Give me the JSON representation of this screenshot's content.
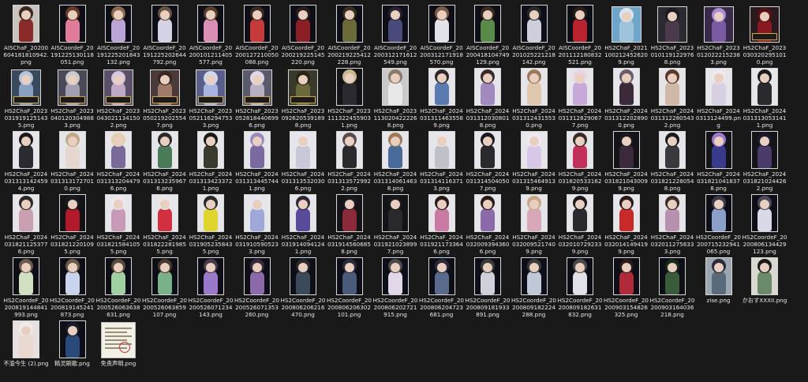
{
  "files": [
    {
      "name": "AISChaF_20200604181810942.png",
      "kind": "portrait",
      "bg": "#c9c3be",
      "fig": "#8b2a2a",
      "hair": "#3a2622"
    },
    {
      "name": "AISCoordeF_20191225130118051.png",
      "kind": "portrait",
      "bg": "#0e0e16",
      "fig": "#e07c9a",
      "hair": "#6a3b2a"
    },
    {
      "name": "AISCoordeF_20191225201843132.png",
      "kind": "portrait",
      "bg": "#0e0e16",
      "fig": "#b9a5d6",
      "hair": "#8a6a4a"
    },
    {
      "name": "AISCoordeF_20191225202644792.png",
      "kind": "portrait",
      "bg": "#0e0e16",
      "fig": "#d6d2e6",
      "hair": "#6a5040"
    },
    {
      "name": "AISCoordeF_20200101211405577.png",
      "kind": "portrait",
      "bg": "#0e0e16",
      "fig": "#d98fb5",
      "hair": "#5a3d2a"
    },
    {
      "name": "AISCoordeF_20200127210050088.png",
      "kind": "portrait",
      "bg": "#0e0e16",
      "fig": "#c73a3a",
      "hair": "#3a2a22"
    },
    {
      "name": "AISCoordeF_20200219225145220.png",
      "kind": "portrait",
      "bg": "#0e0e16",
      "fig": "#8a1f26",
      "hair": "#2a1e1e"
    },
    {
      "name": "AISCoordeF_20200219225412228.png",
      "kind": "portrait",
      "bg": "#0e0e16",
      "fig": "#6a6a3a",
      "hair": "#3a2e20"
    },
    {
      "name": "AISCoordeF_20200312171612549.png",
      "kind": "portrait",
      "bg": "#0e0e16",
      "fig": "#4a4a7a",
      "hair": "#2a2030"
    },
    {
      "name": "AISCoordeF_20200312171918570.png",
      "kind": "portrait",
      "bg": "#0e0e16",
      "fig": "#e2e2ea",
      "hair": "#7a5a4a"
    },
    {
      "name": "AISCoordeF_20200418104749129.png",
      "kind": "portrait",
      "bg": "#0e0e16",
      "fig": "#5a8a4a",
      "hair": "#3a2a20"
    },
    {
      "name": "AISCoordeF_20201025221218142.png",
      "kind": "portrait",
      "bg": "#0e0e16",
      "fig": "#cfcfdc",
      "hair": "#2a2a2a"
    },
    {
      "name": "AISCoordeF_20201112180832521.png",
      "kind": "portrait",
      "bg": "#0e0e16",
      "fig": "#b8232e",
      "hair": "#2a1a1a"
    },
    {
      "name": "HS2ChaF_20211002124526209.png",
      "kind": "square",
      "bg": "#6fa5c9",
      "fig": "#9ec3db",
      "hair": "#d8e4ee"
    },
    {
      "name": "HS2ChaF_20230101191229768.png",
      "kind": "square",
      "bg": "#2a2a30",
      "fig": "#4a3a4a",
      "hair": "#1a1a22"
    },
    {
      "name": "HS2ChaF_20230120222152383.png",
      "kind": "square",
      "bg": "#3a2a4a",
      "fig": "#7a5aa0",
      "hair": "#a78cd6"
    },
    {
      "name": "HS2ChaF_20230303202951010.png",
      "kind": "square",
      "bg": "#2a1a1e",
      "fig": "#8a1a22",
      "hair": "#5a1016",
      "badge": true
    },
    {
      "name": "HS2ChaF_20230319191251435.png",
      "kind": "square",
      "bg": "#3a4a5e",
      "fig": "#8aa0c0",
      "hair": "#b6c4d8",
      "badge": true
    },
    {
      "name": "HS2ChaF_20230401203049883.png",
      "kind": "square",
      "bg": "#4a4a56",
      "fig": "#a0a0b0",
      "hair": "#c8c8d2",
      "badge": true
    },
    {
      "name": "HS2ChaF_20230430211341502.png",
      "kind": "square",
      "bg": "#5a5068",
      "fig": "#c0a8c8",
      "hair": "#d6c6e0",
      "badge": true
    },
    {
      "name": "HS2ChaF_20230502192025547.png",
      "kind": "square",
      "bg": "#4a3a3a",
      "fig": "#a07a6a",
      "hair": "#3a2622",
      "badge": true
    },
    {
      "name": "HS2ChaF_20230521162947533.png",
      "kind": "square",
      "bg": "#5a5e8a",
      "fig": "#a8b4e0",
      "hair": "#d2d8f0",
      "badge": true
    },
    {
      "name": "HS2ChaF_20230528184406996.png",
      "kind": "square",
      "bg": "#5a5a6a",
      "fig": "#b8b0c0",
      "hair": "#e0d8e8",
      "badge": true
    },
    {
      "name": "HS2ChaF_20230926205391898.png",
      "kind": "square",
      "bg": "#3a3a2a",
      "fig": "#6a6a3a",
      "hair": "#2a2418",
      "badge": true
    },
    {
      "name": "HS2ChaF_20231113224559031.png",
      "kind": "portrait",
      "bg": "#141418",
      "fig": "#2a2a30",
      "hair": "#c8b890"
    },
    {
      "name": "HS2ChaF_20231130204222268.png",
      "kind": "portrait",
      "bg": "#c9c9c9",
      "fig": "#e8e8e8",
      "hair": "#8a7a6a"
    },
    {
      "name": "HS2ChaF_20240313114635589.png",
      "kind": "portrait",
      "bg": "#e6e6ea",
      "fig": "#5a7ab0",
      "hair": "#2a2a2a"
    },
    {
      "name": "HS2ChaF_20240313120308018.png",
      "kind": "portrait",
      "bg": "#e6e6ea",
      "fig": "#a08ac0",
      "hair": "#3a2a2a"
    },
    {
      "name": "HS2ChaF_20240313124315530.png",
      "kind": "portrait",
      "bg": "#e6e6ea",
      "fig": "#e0c8b0",
      "hair": "#9a7a5a"
    },
    {
      "name": "HS2ChaF_20240313128290677.png",
      "kind": "portrait",
      "bg": "#e6e6ea",
      "fig": "#c8a8d8",
      "hair": "#e6d6e6"
    },
    {
      "name": "HS2ChaF_20240313122028900.png",
      "kind": "portrait",
      "bg": "#e6e6ea",
      "fig": "#3a2a3a",
      "hair": "#6a5a6a"
    },
    {
      "name": "HS2ChaF_20240313122805432.png",
      "kind": "portrait",
      "bg": "#e6e6ea",
      "fig": "#d0b8a8",
      "hair": "#5a3a2a"
    },
    {
      "name": "HS2ChaF_20240313124499.png",
      "kind": "portrait",
      "bg": "#e6e6ea",
      "fig": "#d6d0e0",
      "hair": "#efe8f0"
    },
    {
      "name": "HS2ChaF_20240313130531411.png",
      "kind": "portrait",
      "bg": "#e6e6ea",
      "fig": "#2a2a2e",
      "hair": "#1a1a1a"
    },
    {
      "name": "HS2ChaF_20240313131424594.png",
      "kind": "portrait",
      "bg": "#e6e6ea",
      "fig": "#2a2a30",
      "hair": "#1a1a1e"
    },
    {
      "name": "HS2ChaF_20240313131727010.png",
      "kind": "portrait",
      "bg": "#e6e6ea",
      "fig": "#e6d6d0",
      "hair": "#c0a888"
    },
    {
      "name": "HS2ChaF_20240313132044796.png",
      "kind": "portrait",
      "bg": "#e6e6ea",
      "fig": "#7a6a9a",
      "hair": "#e0d0b0"
    },
    {
      "name": "HS2ChaF_20240313132359676.png",
      "kind": "portrait",
      "bg": "#e6e6ea",
      "fig": "#4a7a5a",
      "hair": "#2a2a2a"
    },
    {
      "name": "HS2ChaF_20240313134233721.png",
      "kind": "portrait",
      "bg": "#e6e6ea",
      "fig": "#3a3a2e",
      "hair": "#1a1a14"
    },
    {
      "name": "HS2ChaF_20240313134457441.png",
      "kind": "portrait",
      "bg": "#e6e6ea",
      "fig": "#7a6aa0",
      "hair": "#9a8ac0"
    },
    {
      "name": "HS2ChaF_20240313135320306.png",
      "kind": "portrait",
      "bg": "#e6e6ea",
      "fig": "#c8c8d8",
      "hair": "#e6e6f0"
    },
    {
      "name": "HS2ChaF_20240313135729922.png",
      "kind": "portrait",
      "bg": "#e6e6ea",
      "fig": "#2a2a2e",
      "hair": "#5a4a4a"
    },
    {
      "name": "HS2ChaF_20240313140614638.png",
      "kind": "portrait",
      "bg": "#e6e6ea",
      "fig": "#4a6a9a",
      "hair": "#a07a5a"
    },
    {
      "name": "HS2ChaF_20240313141163713.png",
      "kind": "portrait",
      "bg": "#e6e6ea",
      "fig": "#c0c0c8",
      "hair": "#e6e6ea"
    },
    {
      "name": "HS2ChaF_20240313145040507.png",
      "kind": "portrait",
      "bg": "#e6e6ea",
      "fig": "#2a2a2e",
      "hair": "#1a1a1e"
    },
    {
      "name": "HS2ChaF_20240313154649139.png",
      "kind": "portrait",
      "bg": "#e6e6ea",
      "fig": "#d8c8e8",
      "hair": "#eeeaf2"
    },
    {
      "name": "HS2ChaF_20240318205331629.png",
      "kind": "portrait",
      "bg": "#e6e6ea",
      "fig": "#c0305a",
      "hair": "#3a2a2a"
    },
    {
      "name": "HS2ChaF_20240318210430099.png",
      "kind": "portrait",
      "bg": "#141418",
      "fig": "#3a2a3a",
      "hair": "#1a1a1e"
    },
    {
      "name": "HS2ChaF_20240318212280548.png",
      "kind": "portrait",
      "bg": "#e6e6ea",
      "fig": "#3a3a3e",
      "hair": "#1a1a1e"
    },
    {
      "name": "HS2ChaF_20240318210418378.png",
      "kind": "portrait",
      "bg": "#141418",
      "fig": "#3a3a8a",
      "hair": "#9a7acc"
    },
    {
      "name": "HS2ChaF_20240318210244262.png",
      "kind": "portrait",
      "bg": "#141418",
      "fig": "#4a3a6a",
      "hair": "#1a1a2a"
    },
    {
      "name": "HS2ChaF_20240318211253776.png",
      "kind": "portrait",
      "bg": "#e6e6ea",
      "fig": "#c8a0b0",
      "hair": "#2a2a2a"
    },
    {
      "name": "HS2ChaF_20240318212201095.png",
      "kind": "portrait",
      "bg": "#141418",
      "fig": "#b01a2a",
      "hair": "#1a1a1e"
    },
    {
      "name": "HS2ChaF_20240318215841055.png",
      "kind": "portrait",
      "bg": "#e6e6ea",
      "fig": "#c89ab8",
      "hair": "#f0e6ee"
    },
    {
      "name": "HS2ChaF_20240318222819855.png",
      "kind": "portrait",
      "bg": "#e6e6ea",
      "fig": "#d03040",
      "hair": "#e8e8e8"
    },
    {
      "name": "HS2ChaF_20240319052358435.png",
      "kind": "portrait",
      "bg": "#e6e6ea",
      "fig": "#e0d430",
      "hair": "#2a2a2a"
    },
    {
      "name": "HS2ChaF_20240319105905233.png",
      "kind": "portrait",
      "bg": "#e6e6ea",
      "fig": "#a0a8d8",
      "hair": "#e6e6f2"
    },
    {
      "name": "HS2ChaF_20240319140941241.png",
      "kind": "portrait",
      "bg": "#e6e6ea",
      "fig": "#5a4a9a",
      "hair": "#2a2a3a"
    },
    {
      "name": "HS2ChaF_20240319145606858.png",
      "kind": "portrait",
      "bg": "#141418",
      "fig": "#8a2a3a",
      "hair": "#1a1a1e"
    },
    {
      "name": "HS2ChaF_20240319210238997.png",
      "kind": "portrait",
      "bg": "#141418",
      "fig": "#2a2a2e",
      "hair": "#1a1a1e"
    },
    {
      "name": "HS2ChaF_20240319211733646.png",
      "kind": "portrait",
      "bg": "#e6e6ea",
      "fig": "#c87aa0",
      "hair": "#2a1a1a"
    },
    {
      "name": "HS2ChaF_20240320093943606.png",
      "kind": "portrait",
      "bg": "#e6e6ea",
      "fig": "#8a6aa8",
      "hair": "#2a1a1a"
    },
    {
      "name": "HS2ChaF_20240320095217409.png",
      "kind": "portrait",
      "bg": "#e6e6ea",
      "fig": "#d8a8b8",
      "hair": "#c8a888"
    },
    {
      "name": "HS2ChaF_20240320107292339.png",
      "kind": "portrait",
      "bg": "#e6e6ea",
      "fig": "#2a2a2e",
      "hair": "#1a1a1e"
    },
    {
      "name": "HS2ChaF_20240320141494199.png",
      "kind": "portrait",
      "bg": "#e6e6ea",
      "fig": "#c82a2a",
      "hair": "#2a1a1a"
    },
    {
      "name": "HS2ChaF_20240320112756333.png",
      "kind": "portrait",
      "bg": "#e6e6ea",
      "fig": "#b890b0",
      "hair": "#3a2a2a"
    },
    {
      "name": "HS2CoordeF_20200715232941065.png",
      "kind": "portrait",
      "bg": "#0e0e16",
      "fig": "#8aa0c8",
      "hair": "#3a3a4a"
    },
    {
      "name": "HS2CoordeF_20200806134429123.png",
      "kind": "portrait",
      "bg": "#0e0e16",
      "fig": "#d8d8e6",
      "hair": "#4a4a5a"
    },
    {
      "name": "HS2CoordeF_20200819144841993.png",
      "kind": "portrait",
      "bg": "#0e0e16",
      "fig": "#d0e0c0",
      "hair": "#6a5a4a"
    },
    {
      "name": "HS2CoordeF_20200819145241873.png",
      "kind": "portrait",
      "bg": "#0e0e16",
      "fig": "#c8d4ec",
      "hair": "#6a5a4a"
    },
    {
      "name": "HS2CoordeF_20200526063638631.png",
      "kind": "portrait",
      "bg": "#0e0e16",
      "fig": "#a0d0a0",
      "hair": "#5a4a3a"
    },
    {
      "name": "HS2CoordeF_20200526063859107.png",
      "kind": "portrait",
      "bg": "#0e0e16",
      "fig": "#7ab08a",
      "hair": "#4a3a2a"
    },
    {
      "name": "HS2CoordeF_20200526071234143.png",
      "kind": "portrait",
      "bg": "#0e0e16",
      "fig": "#9a7ac8",
      "hair": "#4a3a4a"
    },
    {
      "name": "HS2CoordeF_20200526071353260.png",
      "kind": "portrait",
      "bg": "#0e0e16",
      "fig": "#8a6aa8",
      "hair": "#3a2a3a"
    },
    {
      "name": "HS2CoordeF_20200806206216470.png",
      "kind": "portrait",
      "bg": "#0e0e16",
      "fig": "#3a4a5a",
      "hair": "#2a2a2e"
    },
    {
      "name": "HS2CoordeF_20200806206302101.png",
      "kind": "portrait",
      "bg": "#0e0e16",
      "fig": "#4a5a7a",
      "hair": "#2a2a3a"
    },
    {
      "name": "HS2CoordeF_20200806202721915.png",
      "kind": "portrait",
      "bg": "#0e0e16",
      "fig": "#e0d8e8",
      "hair": "#4a4a4a"
    },
    {
      "name": "HS2CoordeF_20200806204723681.png",
      "kind": "portrait",
      "bg": "#0e0e16",
      "fig": "#5a6a8a",
      "hair": "#2a2a3a"
    },
    {
      "name": "HS2CoordeF_20200809181933891.png",
      "kind": "portrait",
      "bg": "#0e0e16",
      "fig": "#d0d0d8",
      "hair": "#3a3a3a"
    },
    {
      "name": "HS2CoordeF_20200809182224288.png",
      "kind": "portrait",
      "bg": "#0e0e16",
      "fig": "#c0c8d8",
      "hair": "#3a3a3a"
    },
    {
      "name": "HS2CoordeF_20200809182631832.png",
      "kind": "portrait",
      "bg": "#0e0e16",
      "fig": "#e0e0e6",
      "hair": "#4a4a4a"
    },
    {
      "name": "HS2CoordeF_20200903154826325.png",
      "kind": "portrait",
      "bg": "#0e0e16",
      "fig": "#b02a3a",
      "hair": "#2a1a1a"
    },
    {
      "name": "HS2CoordeF_20200903164036218.png",
      "kind": "portrait",
      "bg": "#0e0e16",
      "fig": "#3a5a3a",
      "hair": "#1a2a1a"
    },
    {
      "name": "zise.png",
      "kind": "portrait",
      "bg": "#9aa6b0",
      "fig": "#5a6a7a",
      "hair": "#2a2a3a"
    },
    {
      "name": "かおすXXXII.png",
      "kind": "portrait",
      "bg": "#d8d8d0",
      "fig": "#6a8a6a",
      "hair": "#1a1a1a"
    },
    {
      "name": "不渝今生 (2).png",
      "kind": "portrait",
      "bg": "#e6e0e0",
      "fig": "#e8d8d0",
      "hair": "#f0eaea"
    },
    {
      "name": "精灵刷歌.png",
      "kind": "portrait",
      "bg": "#0e0e16",
      "fig": "#2a4a7a",
      "hair": "#1a1a2a"
    },
    {
      "name": "免责声明.png",
      "kind": "doc",
      "bg": "#f3f0e6",
      "fig": "#9a8f7a",
      "hair": "#c33333"
    }
  ]
}
